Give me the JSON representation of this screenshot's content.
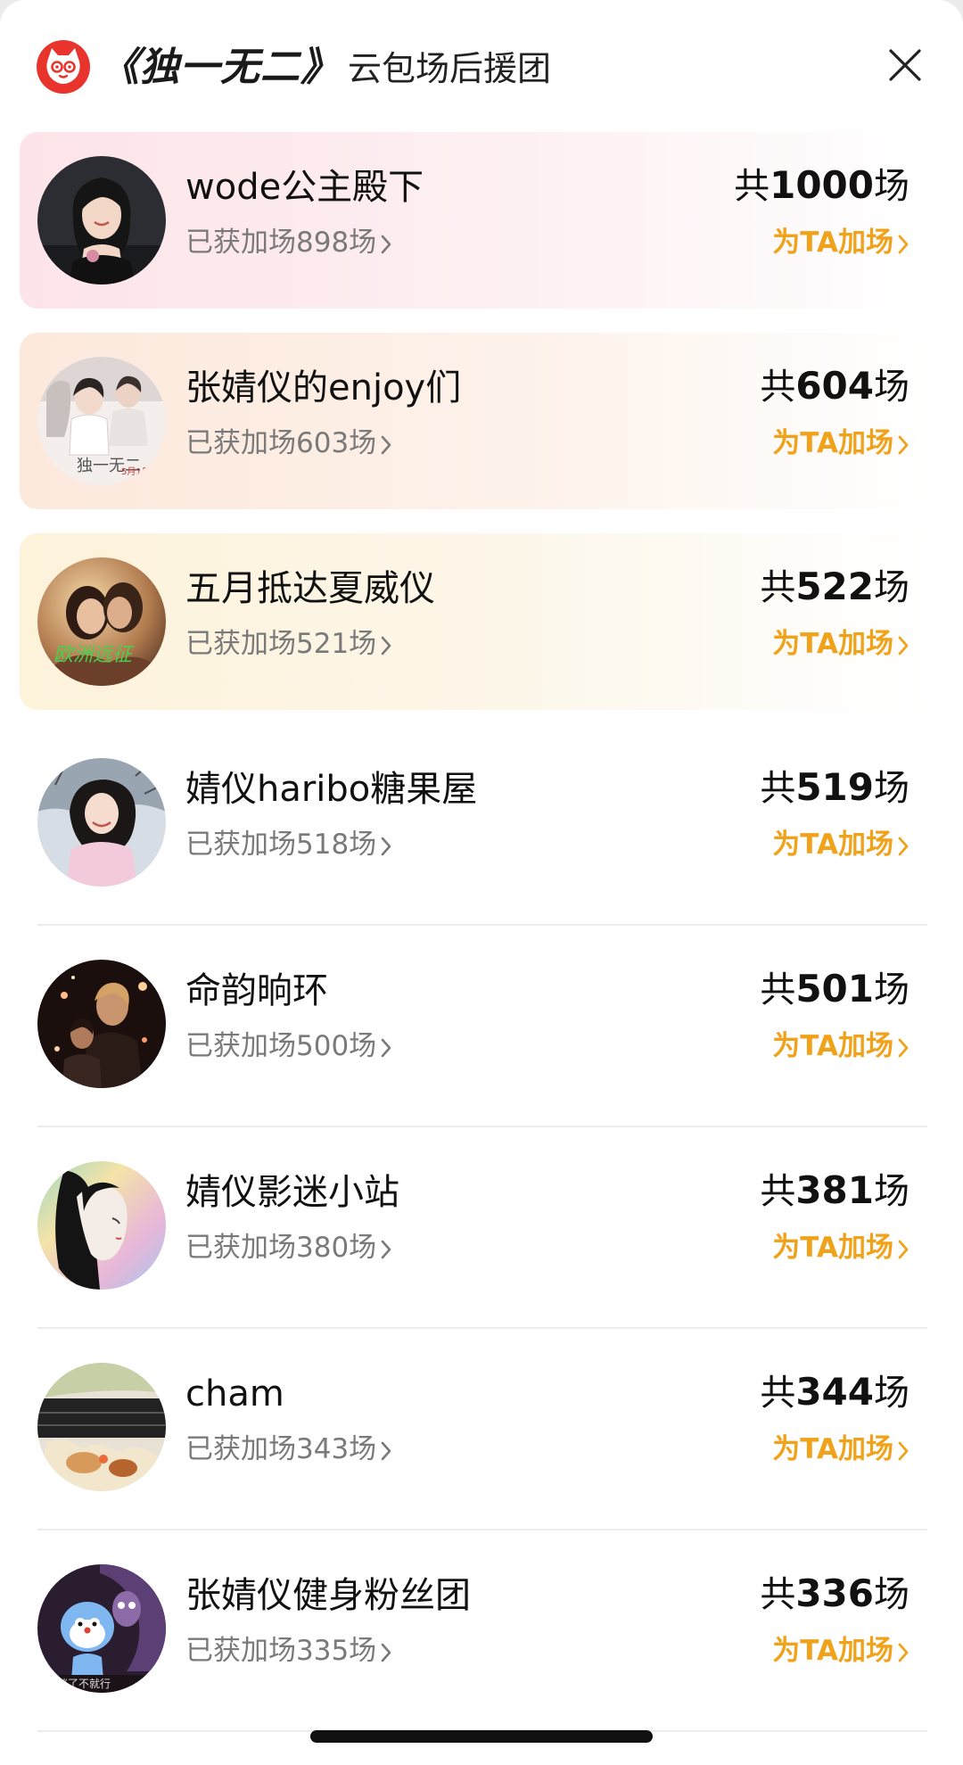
{
  "header": {
    "title_main": "《独一无二》",
    "title_sub": "云包场后援团",
    "logo_icon": "maoyan-cat-logo-icon",
    "close_icon": "close-icon"
  },
  "colors": {
    "accent": "#f0a21b",
    "logo_red": "#e8342c",
    "top1_bg": "#fde4e8",
    "top2_bg": "#fde8dc",
    "top3_bg": "#fdf2da"
  },
  "items": [
    {
      "name": "wode公主殿下",
      "gained": "已获加场898场",
      "total_prefix": "共",
      "total_num": "1000",
      "total_suffix": "场",
      "action": "为TA加场"
    },
    {
      "name": "张婧仪的enjoy们",
      "gained": "已获加场603场",
      "total_prefix": "共",
      "total_num": "604",
      "total_suffix": "场",
      "action": "为TA加场"
    },
    {
      "name": "五月抵达夏威仪",
      "gained": "已获加场521场",
      "total_prefix": "共",
      "total_num": "522",
      "total_suffix": "场",
      "action": "为TA加场"
    },
    {
      "name": "婧仪haribo糖果屋",
      "gained": "已获加场518场",
      "total_prefix": "共",
      "total_num": "519",
      "total_suffix": "场",
      "action": "为TA加场"
    },
    {
      "name": "命韵晌环",
      "gained": "已获加场500场",
      "total_prefix": "共",
      "total_num": "501",
      "total_suffix": "场",
      "action": "为TA加场"
    },
    {
      "name": "婧仪影迷小站",
      "gained": "已获加场380场",
      "total_prefix": "共",
      "total_num": "381",
      "total_suffix": "场",
      "action": "为TA加场"
    },
    {
      "name": "cham",
      "gained": "已获加场343场",
      "total_prefix": "共",
      "total_num": "344",
      "total_suffix": "场",
      "action": "为TA加场"
    },
    {
      "name": "张婧仪健身粉丝团",
      "gained": "已获加场335场",
      "total_prefix": "共",
      "total_num": "336",
      "total_suffix": "场",
      "action": "为TA加场"
    }
  ]
}
